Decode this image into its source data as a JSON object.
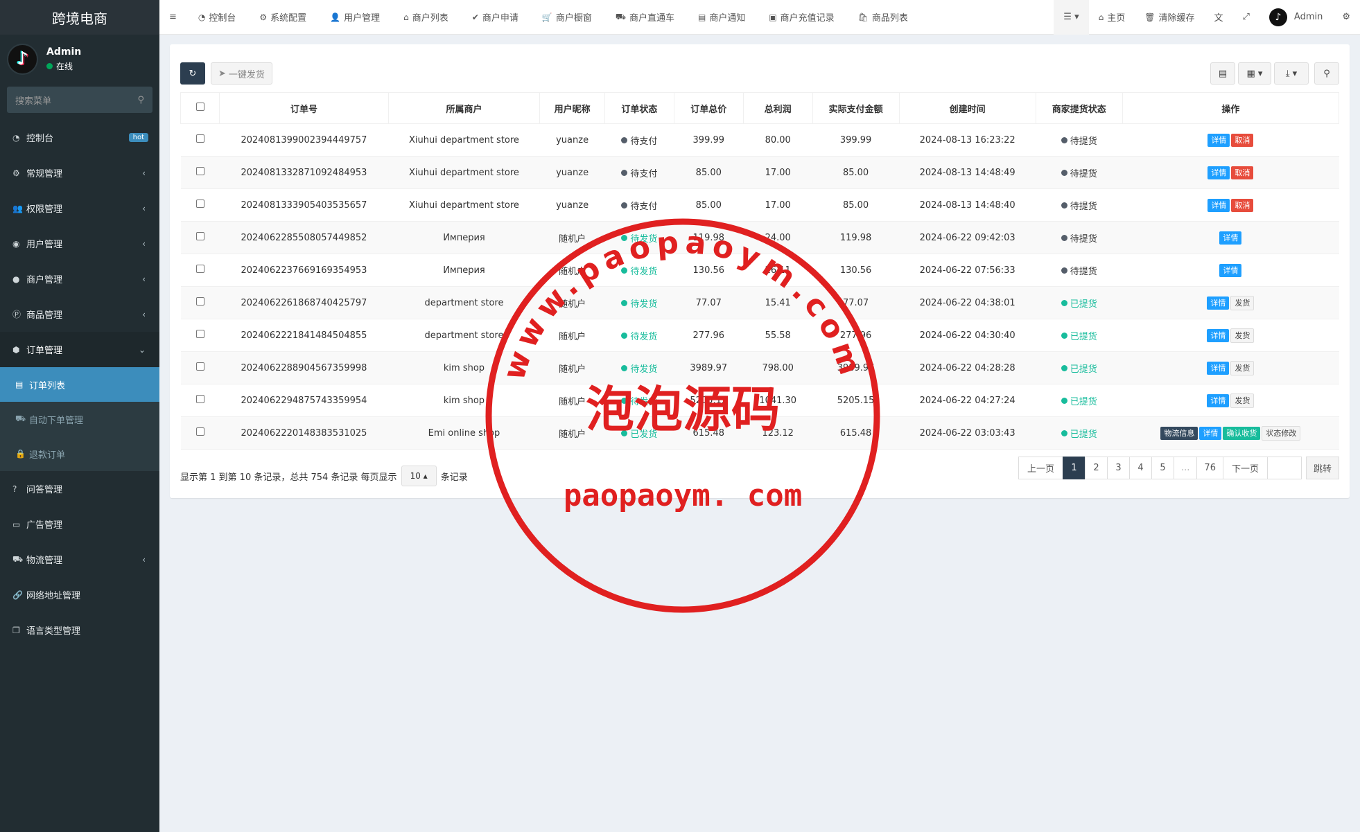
{
  "brand": "跨境电商",
  "user": {
    "name": "Admin",
    "status": "在线",
    "avatar_glyph": "♪"
  },
  "search": {
    "placeholder": "搜索菜单"
  },
  "menu": [
    {
      "label": "控制台",
      "icon": "dashboard-icon",
      "badge": "hot"
    },
    {
      "label": "常规管理",
      "icon": "cogs-icon"
    },
    {
      "label": "权限管理",
      "icon": "group-icon"
    },
    {
      "label": "用户管理",
      "icon": "user-circle-icon"
    },
    {
      "label": "商户管理",
      "icon": "apple-icon"
    },
    {
      "label": "商品管理",
      "icon": "product-hunt-icon"
    },
    {
      "label": "订单管理",
      "icon": "cube-icon"
    }
  ],
  "submenu": [
    {
      "label": "订单列表",
      "icon": "list-alt-icon"
    },
    {
      "label": "自动下单管理",
      "icon": "car-icon"
    },
    {
      "label": "退款订单",
      "icon": "lock-icon"
    }
  ],
  "menu2": [
    {
      "label": "问答管理",
      "icon": "question-circle-icon"
    },
    {
      "label": "广告管理",
      "icon": "credit-card-icon"
    },
    {
      "label": "物流管理",
      "icon": "truck-icon"
    },
    {
      "label": "网络地址管理",
      "icon": "link-icon"
    },
    {
      "label": "语言类型管理",
      "icon": "copy-icon"
    }
  ],
  "topnav": [
    "控制台",
    "系统配置",
    "用户管理",
    "商户列表",
    "商户申请",
    "商户橱窗",
    "商户直通车",
    "商户通知",
    "商户充值记录",
    "商品列表"
  ],
  "topright": {
    "home": "主页",
    "clear_cache": "清除缓存",
    "admin": "Admin"
  },
  "toolbar": {
    "ship_all": "一键发货"
  },
  "columns": [
    "订单号",
    "所属商户",
    "用户昵称",
    "订单状态",
    "订单总价",
    "总利润",
    "实际支付金额",
    "创建时间",
    "商家提货状态",
    "操作"
  ],
  "rows": [
    {
      "order": "2024081399002394449757",
      "merchant": "Xiuhui department store",
      "nick": "yuanze",
      "status": "待支付",
      "total": "399.99",
      "profit": "80.00",
      "paid": "399.99",
      "time": "2024-08-13 16:23:22",
      "pickup": "待提货",
      "actions": [
        "详情",
        "取消"
      ]
    },
    {
      "order": "2024081332871092484953",
      "merchant": "Xiuhui department store",
      "nick": "yuanze",
      "status": "待支付",
      "total": "85.00",
      "profit": "17.00",
      "paid": "85.00",
      "time": "2024-08-13 14:48:49",
      "pickup": "待提货",
      "actions": [
        "详情",
        "取消"
      ]
    },
    {
      "order": "2024081333905403535657",
      "merchant": "Xiuhui department store",
      "nick": "yuanze",
      "status": "待支付",
      "total": "85.00",
      "profit": "17.00",
      "paid": "85.00",
      "time": "2024-08-13 14:48:40",
      "pickup": "待提货",
      "actions": [
        "详情",
        "取消"
      ]
    },
    {
      "order": "2024062285508057449852",
      "merchant": "Империя",
      "nick": "随机户",
      "status": "待发货",
      "total": "119.98",
      "profit": "24.00",
      "paid": "119.98",
      "time": "2024-06-22 09:42:03",
      "pickup": "待提货",
      "actions": [
        "详情"
      ]
    },
    {
      "order": "2024062237669169354953",
      "merchant": "Империя",
      "nick": "随机户",
      "status": "待发货",
      "total": "130.56",
      "profit": "26.11",
      "paid": "130.56",
      "time": "2024-06-22 07:56:33",
      "pickup": "待提货",
      "actions": [
        "详情"
      ]
    },
    {
      "order": "2024062261868740425797",
      "merchant": "department store",
      "nick": "随机户",
      "status": "待发货",
      "total": "77.07",
      "profit": "15.41",
      "paid": "77.07",
      "time": "2024-06-22 04:38:01",
      "pickup": "已提货",
      "actions": [
        "详情",
        "发货"
      ]
    },
    {
      "order": "2024062221841484504855",
      "merchant": "department store",
      "nick": "随机户",
      "status": "待发货",
      "total": "277.96",
      "profit": "55.58",
      "paid": "277.96",
      "time": "2024-06-22 04:30:40",
      "pickup": "已提货",
      "actions": [
        "详情",
        "发货"
      ]
    },
    {
      "order": "2024062288904567359998",
      "merchant": "kim shop",
      "nick": "随机户",
      "status": "待发货",
      "total": "3989.97",
      "profit": "798.00",
      "paid": "3989.97",
      "time": "2024-06-22 04:28:28",
      "pickup": "已提货",
      "actions": [
        "详情",
        "发货"
      ]
    },
    {
      "order": "2024062294875743359954",
      "merchant": "kim shop",
      "nick": "随机户",
      "status": "待发货",
      "total": "5205.15",
      "profit": "1041.30",
      "paid": "5205.15",
      "time": "2024-06-22 04:27:24",
      "pickup": "已提货",
      "actions": [
        "详情",
        "发货"
      ]
    },
    {
      "order": "2024062220148383531025",
      "merchant": "Emi online shop",
      "nick": "随机户",
      "status": "已发货",
      "total": "615.48",
      "profit": "123.12",
      "paid": "615.48",
      "time": "2024-06-22 03:03:43",
      "pickup": "已提货",
      "actions": [
        "物流信息",
        "详情",
        "确认收货",
        "状态修改"
      ]
    }
  ],
  "pager": {
    "prefix": "显示第 1 到第 10 条记录，总共 754 条记录 每页显示",
    "size": "10",
    "suffix": "条记录"
  },
  "pages": [
    "上一页",
    "1",
    "2",
    "3",
    "4",
    "5",
    "...",
    "76",
    "下一页"
  ],
  "goto_label": "跳转",
  "watermark": {
    "arc_text": "www.paopaoym.com",
    "cn": "泡泡源码",
    "bottom": "paopaoym. com"
  },
  "colors": {
    "sidebar": "#222d32",
    "active": "#3c8dbc",
    "primary_btn": "#1e9fff",
    "danger": "#e74c3c",
    "success": "#18bc9c",
    "stamp": "#e02020"
  }
}
